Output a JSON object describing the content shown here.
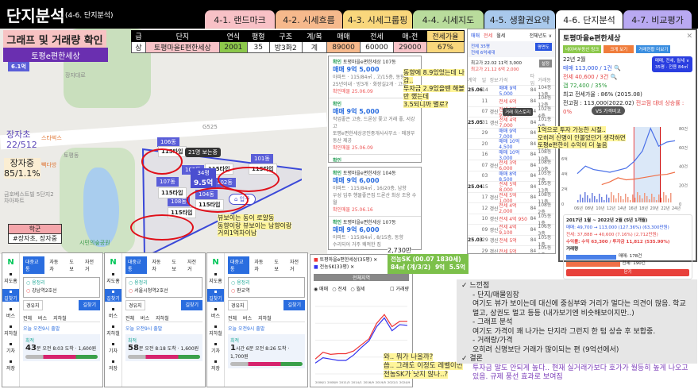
{
  "header": {
    "title": "단지분석",
    "subtitle": "(4-6. 단지분석)"
  },
  "tabs": [
    {
      "label": "4-1. 랜드마크",
      "color": "#f8c1c6"
    },
    {
      "label": "4-2. 시세흐름",
      "color": "#f6b98c"
    },
    {
      "label": "4-3. 시세그룹핑",
      "color": "#f9d77c"
    },
    {
      "label": "4-4. 시세지도",
      "color": "#b9dc9c"
    },
    {
      "label": "4-5. 생활권요약",
      "color": "#a9c9ec"
    },
    {
      "label": "4-6. 단지분석",
      "color": "#ffffff"
    },
    {
      "label": "4-7. 비교평가",
      "color": "#b9a9f2"
    }
  ],
  "section_label": "그래프 및 거래량 확인",
  "complex_label": "토평e편한세상",
  "table": {
    "headers": [
      "급",
      "단지",
      "연식",
      "평형",
      "구조",
      "계/복",
      "매매",
      "전세",
      "매-전",
      "전세가율"
    ],
    "row": [
      "상",
      "토평마을E편한세상",
      "2001",
      "35",
      "방3화2",
      "계",
      "89000",
      "60000",
      "29000",
      "67%"
    ]
  },
  "map": {
    "price_pin": "6.1억",
    "school1": "장자초",
    "school1_stat": "22/512",
    "school2": "장자중",
    "school2_stat": "85/1.1%",
    "school_box_title": "학군",
    "school_box_value": "#장자초, 장자중",
    "places": [
      "스타벅스",
      "빽다방",
      "금호베스트빌 5단지2차아파트",
      "시민의숲공원",
      "장자대로",
      "토평동",
      "G525"
    ],
    "buildings": [
      "106동",
      "105동",
      "107동",
      "108동",
      "101동",
      "102동",
      "104동"
    ],
    "type_label": "115타입",
    "viewers": "21명 보는중",
    "selected_py": "34평",
    "selected_price": "9.5억",
    "entrance": "입구",
    "annotation": [
      "뷰보이는 동이 로얄동",
      "동향이랑 뷰보이는 남향이랑",
      "거의1억차이남"
    ]
  },
  "listings_top": [
    {
      "tag": "확인",
      "name": "토평마을e편한세상 107동",
      "price": "매매 9억 5,000",
      "desc": "아파트 · 115/84㎡ , 고/15층, 동향",
      "sub": "25년이내 · 방3개 · 화장실2개 · 고층",
      "date": "확인매물 25.06.09"
    },
    {
      "tag": "확인",
      "name": "",
      "price": "매매 9억 5,000",
      "desc": "작업좋은 고층, 드론상 쫓고 거래 좋, 서강고",
      "sub": "토평e편한세상공인중개사사무소 · 매경부동산 제공",
      "date": "확인매물 25.06.09"
    },
    {
      "tag": "확인",
      "name": "",
      "price": "매매 9억 5,000",
      "desc": "소유자직접의뢰 프로산 거래좋음 고층, 남향 입주협의",
      "sub": "e편한세상공인중개사사무소 · 매경부동산 제공",
      "date": "확인매물 25.06.04"
    }
  ],
  "listings_bottom": [
    {
      "tag": "확인",
      "name": "토평마을e편한세상 104동",
      "price": "매매 9억 6,000",
      "desc": "아파트 · 115/84㎡ , 16/20층, 남향",
      "sub": "우성 입주 행물좋은집 드론산 최상 조용 수월",
      "date": "확인매물 25.06.16"
    },
    {
      "tag": "확인",
      "name": "토평마을e편한세상 107동",
      "price": "매매 9억 6,000",
      "desc": "아파트 · 115/84㎡ , 8/15층, 동향",
      "sub": "수리되어 거주 쾌적한 집",
      "date": ""
    }
  ],
  "annotation_invest": [
    "동향에 8.9있었는데 나감..",
    "투자금 2.9있을땐 해볼만 했는데",
    "3.5되니까 별로?"
  ],
  "price_tag": "2,730만",
  "compare_box": {
    "title": "전농SK (00.07 1830세)",
    "spec": "84㎡ (계/3/2)",
    "sale": "9억",
    "jeonse": "5.5억"
  },
  "trade_list": {
    "tabs": [
      "매매",
      "전세",
      "월세"
    ],
    "filter": "전체년도 ∨",
    "summary1": "전체 35평",
    "summary2": "전체 6억세대",
    "btn": "평면도",
    "max1": "최고가 22.02 11억 3,000",
    "max2": "최고가 21.12 6억 2,000",
    "btn2": "설정",
    "headers": [
      "계약",
      "일",
      "정보",
      "가격",
      "타입",
      "거래동"
    ],
    "tooltip": "거래 히스토리",
    "rows": [
      {
        "m": "25.06",
        "d": "14",
        "i": "",
        "p": "매매 9억 5,000",
        "t": "84",
        "b": "104동 13층",
        "k": "s"
      },
      {
        "m": "",
        "d": "11",
        "i": "",
        "p": "전세 6억",
        "t": "84",
        "b": "104동 12층",
        "k": "j"
      },
      {
        "m": "",
        "d": "07",
        "i": "갱신",
        "p": "전세 5억 9,000",
        "t": "84",
        "b": "102동 4층",
        "k": "j"
      },
      {
        "m": "25.05",
        "d": "31",
        "i": "갱신",
        "p": "전세 4억 7,000",
        "t": "84",
        "b": "101동 9층",
        "k": "j"
      },
      {
        "m": "",
        "d": "29",
        "i": "",
        "p": "매매 9억 7,000",
        "t": "84",
        "b": "101동 10층",
        "k": "s"
      },
      {
        "m": "",
        "d": "20",
        "i": "",
        "p": "매매 10억 4,500",
        "t": "84",
        "b": "103동 15층",
        "k": "s"
      },
      {
        "m": "",
        "d": "16",
        "i": "",
        "p": "매매 10억 3,000",
        "t": "84",
        "b": "108동 10층",
        "k": "s"
      },
      {
        "m": "",
        "d": "07",
        "i": "갱신",
        "p": "전세 3억 6,000",
        "t": "84",
        "b": "108동 10층",
        "k": "j"
      },
      {
        "m": "",
        "d": "03",
        "i": "",
        "p": "매매 8억 8,500",
        "t": "84",
        "b": "105동 7층",
        "k": "s"
      },
      {
        "m": "25.04",
        "d": "15",
        "i": "",
        "p": "전세 5억 8,000",
        "t": "84",
        "b": "105동 13층",
        "k": "j"
      },
      {
        "m": "",
        "d": "17",
        "i": "갱신",
        "p": "전세 5억 1,000",
        "t": "84",
        "b": "108동 11층",
        "k": "j"
      },
      {
        "m": "",
        "d": "12",
        "i": "갱신",
        "p": "전세 4억 2,000",
        "t": "84",
        "b": "108동 2층",
        "k": "j"
      },
      {
        "m": "",
        "d": "10",
        "i": "갱신",
        "p": "전세 4억 950",
        "t": "84",
        "b": "105동 1층",
        "k": "j"
      },
      {
        "m": "",
        "d": "09",
        "i": "갱신",
        "p": "전세 4억 9,100",
        "t": "84",
        "b": "106동 3층",
        "k": "j"
      },
      {
        "m": "25.03",
        "d": "29",
        "i": "갱신",
        "p": "전세 5억",
        "t": "84",
        "b": "105동 1층",
        "k": "j"
      },
      {
        "m": "",
        "d": "29",
        "i": "갱신",
        "p": "전세 5억",
        "t": "84",
        "b": "105동 1층",
        "k": "j"
      },
      {
        "m": "",
        "d": "22",
        "i": "",
        "p": "매매 9억 2,500",
        "t": "84",
        "b": "102동 15층",
        "k": "s"
      },
      {
        "m": "",
        "d": "17",
        "i": "",
        "p": "매매 9억 6,000",
        "t": "84",
        "b": "105동 9층",
        "k": "s"
      },
      {
        "m": "",
        "d": "10",
        "i": "",
        "p": "전세 5억 1,000",
        "t": "84",
        "b": "104동 8층",
        "k": "j"
      },
      {
        "m": "",
        "d": "09",
        "i": "",
        "p": "전세 4억 580",
        "t": "84",
        "b": "106동 14층",
        "k": "j"
      },
      {
        "m": "",
        "d": "08",
        "i": "",
        "p": "전세 5억 1,000",
        "t": "84",
        "b": "104동 10층",
        "k": "j"
      }
    ]
  },
  "detail": {
    "title": "토평마을e편한세상",
    "links": [
      "네이버부동산 링크",
      "크게 보기",
      "거래현황 더보기"
    ],
    "date": "22년 2월",
    "sale": "매매 113,000 / 1건",
    "jeonse": "전세 40,600 / 3건",
    "gap": "갭 72,400 / 35%",
    "max_ratio": "최고 전세가율 : 86% (2015.08)",
    "peak": "전고점 : 113,000(2022.02)",
    "peak_rise": "전고점 대비 상승률 : 0%",
    "filter": "매매, 전세, 월세 ∨",
    "filter2": "35평 · 전용 84㎡",
    "vs_btn": "VS 가격비교",
    "annotation": [
      "1억으로 투자 가능한 시절..",
      "오히려 신명이 안볼었던거 생각하면",
      "토평e편한이 수익이 더 높음"
    ],
    "period": "2017년 1월 ~ 2022년 2월 (5년 1개월)",
    "sale_change": "매매: 49,700 → 113,000 (127.36%) (63,300만원)",
    "jeonse_change": "전세: 37,888 → 40,600 (7.16%) (2,712만원)",
    "profit": "수익률: 수익 63,300 / 투자금 11,812 (535.90%)",
    "volume_label": "거래량",
    "vol_sale": "매매: 178건",
    "vol_jeonse": "전세: 190건",
    "vol_sale_frac": 0.7,
    "vol_jeonse_frac": 0.75,
    "close": "닫기",
    "x_ticks": [
      "06년",
      "08년",
      "10년",
      "12년",
      "14년",
      "16년",
      "18년",
      "20년",
      "22년",
      "24년"
    ],
    "y_left": [
      "10억",
      "8억",
      "6억",
      "4억",
      "2억",
      "0"
    ],
    "y_right": [
      "80건",
      "60건",
      "40건",
      "20건",
      "0"
    ]
  },
  "transit": [
    {
      "from": "용정리",
      "to": "강남역2호선",
      "time": "43",
      "unit": "분",
      "info": "오전 8:03 도착 · 1,600원"
    },
    {
      "from": "용정리",
      "to": "서울시청역2호선",
      "time": "58",
      "unit": "분",
      "info": "오전 8:18 도착 · 1,600원"
    },
    {
      "from": "용정리",
      "to": "판교역",
      "time": "1",
      "unit": "시간 6분",
      "info": "오전 8:26 도착 · 1,700원"
    }
  ],
  "transit_ui": {
    "logo": "N",
    "modes": [
      "대중교통",
      "자동차",
      "도보",
      "자전거"
    ],
    "search": "길찾기",
    "via": "경유지",
    "tabs": [
      "전체",
      "버스",
      "지하철"
    ],
    "badge": "오늘 오전9시 출발",
    "side": [
      "지도홈",
      "길찾기",
      "버스",
      "지하철",
      "기차",
      "저장"
    ],
    "label": "최적"
  },
  "compare_chart": {
    "legend": [
      "토평마을e편한세상(35평)",
      "전농SK(33평)"
    ],
    "header": "전체지역",
    "filters": [
      "매매",
      "전세",
      "월세"
    ],
    "volume": "거래량",
    "x_ticks": [
      "2006/1",
      "2008/9",
      "2011/5",
      "2014/1",
      "2016/9",
      "2019/5",
      "2022/1",
      "2024/9"
    ],
    "annotation": [
      "와.. 뭐가 나올까?",
      "씁.. 그래도 이정도 레벨이면",
      "전농SK가 낫지 않나..?"
    ]
  },
  "chart_data": {
    "type": "line",
    "title": "전체지역",
    "x": [
      "2006",
      "2008",
      "2010",
      "2012",
      "2014",
      "2016",
      "2018",
      "2019",
      "2020",
      "2021",
      "2022",
      "2023",
      "2024"
    ],
    "series": [
      {
        "name": "토평마을e편한세상(35평)",
        "values": [
          4.2,
          5.2,
          4.9,
          5.0,
          5.0,
          5.4,
          6.3,
          7.2,
          9.5,
          10.8,
          9.0,
          9.8,
          9.8
        ]
      },
      {
        "name": "전농SK(33평)",
        "values": [
          3.6,
          4.4,
          4.2,
          4.0,
          4.0,
          4.8,
          5.9,
          6.9,
          9.0,
          10.3,
          8.4,
          9.3,
          9.2
        ]
      }
    ],
    "ylabel": "억"
  },
  "notes": [
    {
      "type": "check",
      "text": "느낀점"
    },
    {
      "type": "sub",
      "text": "- 단지/매물임장"
    },
    {
      "type": "body",
      "text": "여기도 뷰가 보이는데 대신에 중심부와 거리가 멀다는 의견이 많음. 학교 멀고, 상권도 멀고 등등 (내가보기엔 비슷해보이지만..)"
    },
    {
      "type": "sub",
      "text": "- 그래프 분석"
    },
    {
      "type": "body",
      "text": "여기도 가격이 꽤 나가는 단지라 그런지 한 텀 상승 후 보합중."
    },
    {
      "type": "sub",
      "text": "- 거래량/가격"
    },
    {
      "type": "body",
      "text": "오히려 신명보단 거래가 많이되는 편 (9억선에서)"
    },
    {
      "type": "check",
      "text": "결론"
    },
    {
      "type": "purple",
      "text": "투자금 말도 안되게 높다.. 현재 실거래가보다 호가가 월등히 높게 나오고 있음. 규제 풍선 효과로 보여짐"
    }
  ]
}
